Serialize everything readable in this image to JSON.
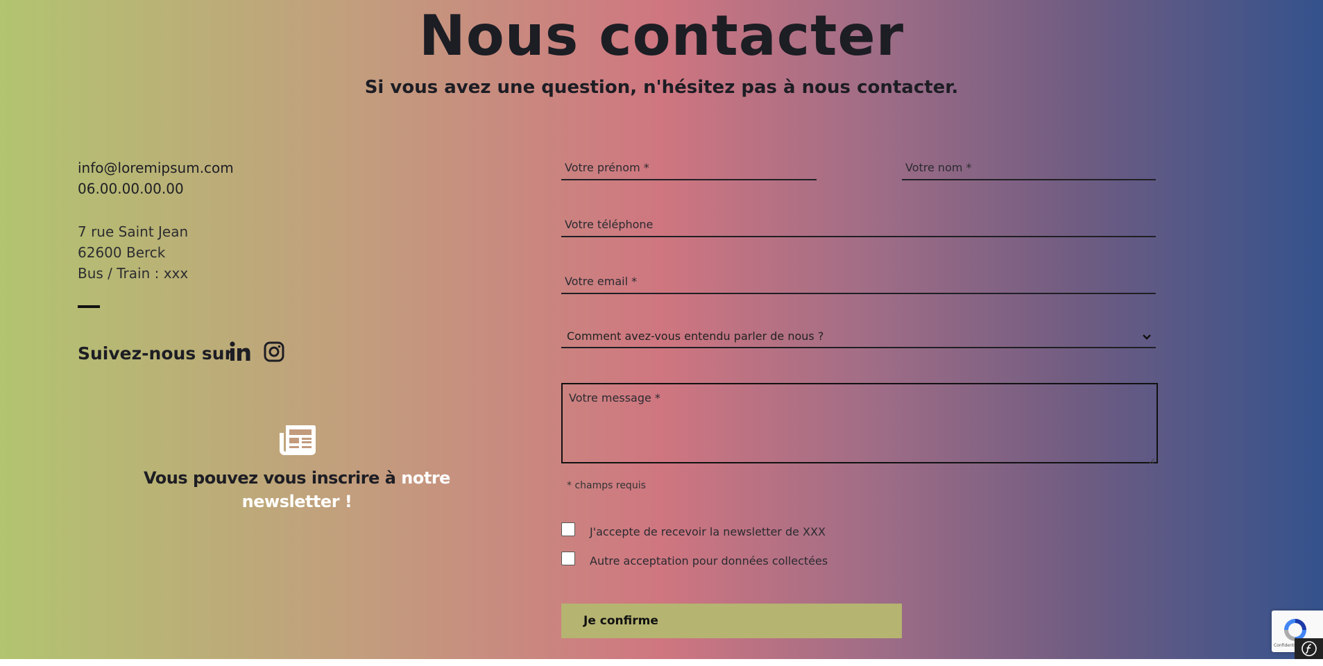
{
  "header": {
    "title": "Nous contacter",
    "subtitle": "Si vous avez une question, n'hésitez pas à nous contacter."
  },
  "contact": {
    "email": "info@loremipsum.com",
    "phone": "06.00.00.00.00",
    "address_line1": "7 rue Saint Jean",
    "address_line2": "62600 Berck",
    "transport": "Bus / Train : xxx"
  },
  "social": {
    "label": "Suivez-nous sur",
    "icons": [
      "linkedin-icon",
      "instagram-icon"
    ]
  },
  "newsletter_promo": {
    "text_prefix": "Vous pouvez vous inscrire à ",
    "text_highlight": "notre newsletter !",
    "icon": "newspaper-icon"
  },
  "form": {
    "firstname_placeholder": "Votre prénom *",
    "lastname_placeholder": "Votre nom *",
    "phone_placeholder": "Votre téléphone",
    "email_placeholder": "Votre email *",
    "source_select_value": "Comment avez-vous entendu parler de nous ?",
    "message_placeholder": "Votre message *",
    "required_note": "* champs requis",
    "checkbox_newsletter_label": "J'accepte de recevoir la newsletter de XXX",
    "checkbox_data_label": "Autre acceptation pour données collectées",
    "submit_label": "Je confirme"
  },
  "recaptcha": {
    "label": "Confidentialité"
  },
  "colors": {
    "gradient_start": "#b2c470",
    "gradient_mid": "#cf7680",
    "gradient_end": "#34528c",
    "button": "#b5b471",
    "text": "#1d1d24"
  }
}
